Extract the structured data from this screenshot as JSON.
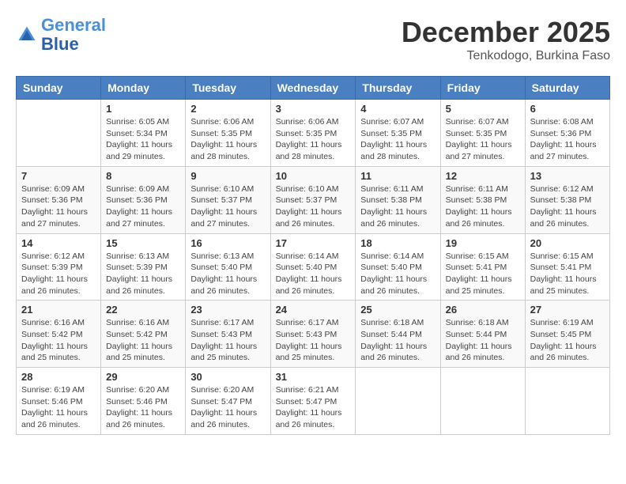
{
  "logo": {
    "line1": "General",
    "line2": "Blue"
  },
  "title": "December 2025",
  "location": "Tenkodogo, Burkina Faso",
  "weekdays": [
    "Sunday",
    "Monday",
    "Tuesday",
    "Wednesday",
    "Thursday",
    "Friday",
    "Saturday"
  ],
  "weeks": [
    [
      {
        "day": "",
        "sunrise": "",
        "sunset": "",
        "daylight": ""
      },
      {
        "day": "1",
        "sunrise": "Sunrise: 6:05 AM",
        "sunset": "Sunset: 5:34 PM",
        "daylight": "Daylight: 11 hours and 29 minutes."
      },
      {
        "day": "2",
        "sunrise": "Sunrise: 6:06 AM",
        "sunset": "Sunset: 5:35 PM",
        "daylight": "Daylight: 11 hours and 28 minutes."
      },
      {
        "day": "3",
        "sunrise": "Sunrise: 6:06 AM",
        "sunset": "Sunset: 5:35 PM",
        "daylight": "Daylight: 11 hours and 28 minutes."
      },
      {
        "day": "4",
        "sunrise": "Sunrise: 6:07 AM",
        "sunset": "Sunset: 5:35 PM",
        "daylight": "Daylight: 11 hours and 28 minutes."
      },
      {
        "day": "5",
        "sunrise": "Sunrise: 6:07 AM",
        "sunset": "Sunset: 5:35 PM",
        "daylight": "Daylight: 11 hours and 27 minutes."
      },
      {
        "day": "6",
        "sunrise": "Sunrise: 6:08 AM",
        "sunset": "Sunset: 5:36 PM",
        "daylight": "Daylight: 11 hours and 27 minutes."
      }
    ],
    [
      {
        "day": "7",
        "sunrise": "Sunrise: 6:09 AM",
        "sunset": "Sunset: 5:36 PM",
        "daylight": "Daylight: 11 hours and 27 minutes."
      },
      {
        "day": "8",
        "sunrise": "Sunrise: 6:09 AM",
        "sunset": "Sunset: 5:36 PM",
        "daylight": "Daylight: 11 hours and 27 minutes."
      },
      {
        "day": "9",
        "sunrise": "Sunrise: 6:10 AM",
        "sunset": "Sunset: 5:37 PM",
        "daylight": "Daylight: 11 hours and 27 minutes."
      },
      {
        "day": "10",
        "sunrise": "Sunrise: 6:10 AM",
        "sunset": "Sunset: 5:37 PM",
        "daylight": "Daylight: 11 hours and 26 minutes."
      },
      {
        "day": "11",
        "sunrise": "Sunrise: 6:11 AM",
        "sunset": "Sunset: 5:38 PM",
        "daylight": "Daylight: 11 hours and 26 minutes."
      },
      {
        "day": "12",
        "sunrise": "Sunrise: 6:11 AM",
        "sunset": "Sunset: 5:38 PM",
        "daylight": "Daylight: 11 hours and 26 minutes."
      },
      {
        "day": "13",
        "sunrise": "Sunrise: 6:12 AM",
        "sunset": "Sunset: 5:38 PM",
        "daylight": "Daylight: 11 hours and 26 minutes."
      }
    ],
    [
      {
        "day": "14",
        "sunrise": "Sunrise: 6:12 AM",
        "sunset": "Sunset: 5:39 PM",
        "daylight": "Daylight: 11 hours and 26 minutes."
      },
      {
        "day": "15",
        "sunrise": "Sunrise: 6:13 AM",
        "sunset": "Sunset: 5:39 PM",
        "daylight": "Daylight: 11 hours and 26 minutes."
      },
      {
        "day": "16",
        "sunrise": "Sunrise: 6:13 AM",
        "sunset": "Sunset: 5:40 PM",
        "daylight": "Daylight: 11 hours and 26 minutes."
      },
      {
        "day": "17",
        "sunrise": "Sunrise: 6:14 AM",
        "sunset": "Sunset: 5:40 PM",
        "daylight": "Daylight: 11 hours and 26 minutes."
      },
      {
        "day": "18",
        "sunrise": "Sunrise: 6:14 AM",
        "sunset": "Sunset: 5:40 PM",
        "daylight": "Daylight: 11 hours and 26 minutes."
      },
      {
        "day": "19",
        "sunrise": "Sunrise: 6:15 AM",
        "sunset": "Sunset: 5:41 PM",
        "daylight": "Daylight: 11 hours and 25 minutes."
      },
      {
        "day": "20",
        "sunrise": "Sunrise: 6:15 AM",
        "sunset": "Sunset: 5:41 PM",
        "daylight": "Daylight: 11 hours and 25 minutes."
      }
    ],
    [
      {
        "day": "21",
        "sunrise": "Sunrise: 6:16 AM",
        "sunset": "Sunset: 5:42 PM",
        "daylight": "Daylight: 11 hours and 25 minutes."
      },
      {
        "day": "22",
        "sunrise": "Sunrise: 6:16 AM",
        "sunset": "Sunset: 5:42 PM",
        "daylight": "Daylight: 11 hours and 25 minutes."
      },
      {
        "day": "23",
        "sunrise": "Sunrise: 6:17 AM",
        "sunset": "Sunset: 5:43 PM",
        "daylight": "Daylight: 11 hours and 25 minutes."
      },
      {
        "day": "24",
        "sunrise": "Sunrise: 6:17 AM",
        "sunset": "Sunset: 5:43 PM",
        "daylight": "Daylight: 11 hours and 25 minutes."
      },
      {
        "day": "25",
        "sunrise": "Sunrise: 6:18 AM",
        "sunset": "Sunset: 5:44 PM",
        "daylight": "Daylight: 11 hours and 26 minutes."
      },
      {
        "day": "26",
        "sunrise": "Sunrise: 6:18 AM",
        "sunset": "Sunset: 5:44 PM",
        "daylight": "Daylight: 11 hours and 26 minutes."
      },
      {
        "day": "27",
        "sunrise": "Sunrise: 6:19 AM",
        "sunset": "Sunset: 5:45 PM",
        "daylight": "Daylight: 11 hours and 26 minutes."
      }
    ],
    [
      {
        "day": "28",
        "sunrise": "Sunrise: 6:19 AM",
        "sunset": "Sunset: 5:46 PM",
        "daylight": "Daylight: 11 hours and 26 minutes."
      },
      {
        "day": "29",
        "sunrise": "Sunrise: 6:20 AM",
        "sunset": "Sunset: 5:46 PM",
        "daylight": "Daylight: 11 hours and 26 minutes."
      },
      {
        "day": "30",
        "sunrise": "Sunrise: 6:20 AM",
        "sunset": "Sunset: 5:47 PM",
        "daylight": "Daylight: 11 hours and 26 minutes."
      },
      {
        "day": "31",
        "sunrise": "Sunrise: 6:21 AM",
        "sunset": "Sunset: 5:47 PM",
        "daylight": "Daylight: 11 hours and 26 minutes."
      },
      {
        "day": "",
        "sunrise": "",
        "sunset": "",
        "daylight": ""
      },
      {
        "day": "",
        "sunrise": "",
        "sunset": "",
        "daylight": ""
      },
      {
        "day": "",
        "sunrise": "",
        "sunset": "",
        "daylight": ""
      }
    ]
  ]
}
